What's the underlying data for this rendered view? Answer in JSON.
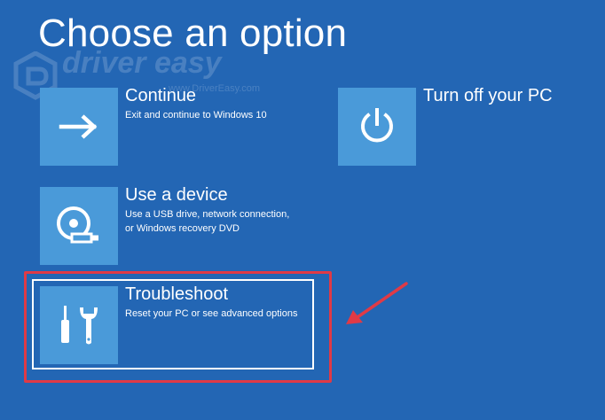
{
  "screen": {
    "title": "Choose an option",
    "background_color": "#2366b4",
    "tile_color": "#4a9ad9",
    "highlight_color": "#e03a46"
  },
  "watermark": {
    "brand": "driver easy",
    "url": "www.DriverEasy.com"
  },
  "options": [
    {
      "label": "Continue",
      "description": [
        "Exit and continue to Windows 10"
      ],
      "icon": "arrow-right-icon"
    },
    {
      "label": "Use a device",
      "description": [
        "Use a USB drive, network connection,",
        "or Windows recovery DVD"
      ],
      "icon": "disc-usb-icon"
    },
    {
      "label": "Troubleshoot",
      "description": [
        "Reset your PC or see advanced options"
      ],
      "icon": "tools-icon",
      "selected": true
    },
    {
      "label": "Turn off your PC",
      "description": [],
      "icon": "power-icon"
    }
  ],
  "annotation": {
    "type": "red-arrow-and-box",
    "target": "Troubleshoot"
  }
}
